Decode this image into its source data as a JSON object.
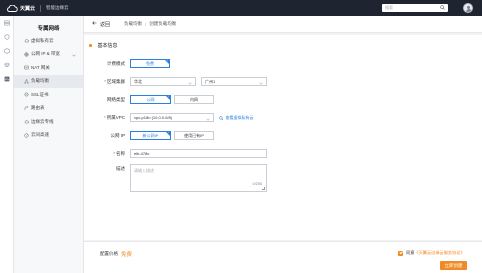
{
  "topbar": {
    "brand": "天翼云",
    "title": "智能边缘云",
    "search_placeholder": "搜索"
  },
  "sidebar": {
    "title": "专属网络",
    "items": [
      {
        "label": "虚拟私有云",
        "icon": "cloud-icon"
      },
      {
        "label": "公网 IP & 带宽",
        "icon": "globe-icon"
      },
      {
        "label": "NAT 网关",
        "icon": "nat-icon"
      },
      {
        "label": "负载均衡",
        "icon": "balance-icon"
      },
      {
        "label": "SSL证书",
        "icon": "certificate-icon"
      },
      {
        "label": "路由表",
        "icon": "route-icon"
      },
      {
        "label": "边缘云专线",
        "icon": "line-icon"
      },
      {
        "label": "云间高速",
        "icon": "speed-icon"
      }
    ]
  },
  "header": {
    "back_label": "返回",
    "breadcrumb": [
      "负载均衡",
      "创建负载均衡"
    ]
  },
  "form": {
    "section_title": "基本信息",
    "billing": {
      "label": "计费模式",
      "option": "免费"
    },
    "region": {
      "label": "区域集群",
      "value1": "华北",
      "value2": "广州1"
    },
    "network_type": {
      "label": "网络类型",
      "options": [
        "公网",
        "内网"
      ],
      "selected": "公网"
    },
    "vpc": {
      "label": "所属VPC",
      "value": "vpc-p18n (10.0.0.0/8)",
      "link": "查看虚拟私有云"
    },
    "public_ip": {
      "label": "公网 IP",
      "options": [
        "新公网IP",
        "使用已有IP"
      ],
      "selected": "新公网IP"
    },
    "name": {
      "label": "名称",
      "value": "elb-478c"
    },
    "desc": {
      "label": "描述",
      "placeholder": "请输入描述",
      "counter": "0/255"
    }
  },
  "footer": {
    "price_label": "配置价格",
    "price_value": "免费",
    "agree_prefix": "同意",
    "agree_terms": "《天翼云边缘云服务协议》",
    "submit_label": "立即创建"
  },
  "colors": {
    "accent": "#f08a24",
    "primary": "#2b7fe0",
    "topbar": "#1f2530"
  }
}
